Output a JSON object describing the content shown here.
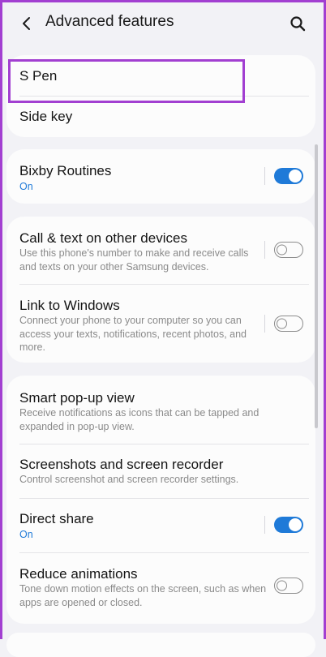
{
  "header": {
    "title": "Advanced features"
  },
  "sections": [
    {
      "items": [
        {
          "title": "S Pen"
        },
        {
          "title": "Side key"
        }
      ]
    },
    {
      "items": [
        {
          "title": "Bixby Routines",
          "status": "On",
          "toggle": true
        }
      ]
    },
    {
      "items": [
        {
          "title": "Call & text on other devices",
          "desc": "Use this phone's number to make and receive calls and texts on your other Samsung devices.",
          "toggle": false
        },
        {
          "title": "Link to Windows",
          "desc": "Connect your phone to your computer so you can access your texts, notifications, recent photos, and more.",
          "toggle": false
        }
      ]
    },
    {
      "items": [
        {
          "title": "Smart pop-up view",
          "desc": "Receive notifications as icons that can be tapped and expanded in pop-up view."
        },
        {
          "title": "Screenshots and screen recorder",
          "desc": "Control screenshot and screen recorder settings."
        },
        {
          "title": "Direct share",
          "status": "On",
          "toggle": true
        },
        {
          "title": "Reduce animations",
          "desc": "Tone down motion effects on the screen, such as when apps are opened or closed.",
          "toggle": false
        }
      ]
    }
  ],
  "colors": {
    "accent": "#1f7ad8",
    "highlight": "#a23fd1",
    "background": "#f2f2f6",
    "card": "#fcfcfc"
  }
}
